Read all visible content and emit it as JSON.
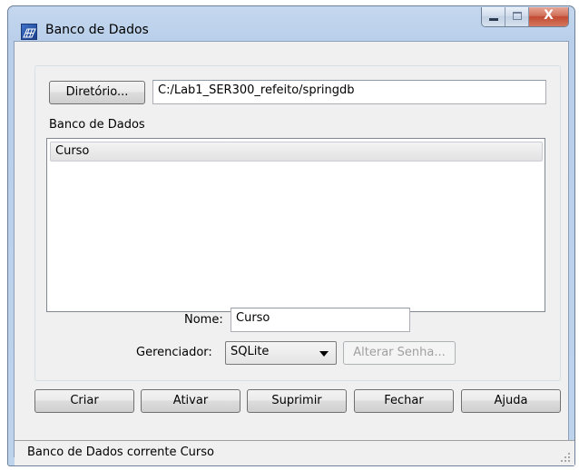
{
  "window": {
    "title": "Banco de Dados",
    "close_glyph": "X",
    "icon": "database-grid-icon"
  },
  "directory": {
    "button_label": "Diretório...",
    "path": "C:/Lab1_SER300_refeito/springdb"
  },
  "database_list": {
    "label": "Banco de Dados",
    "items": [
      "Curso"
    ]
  },
  "name_field": {
    "label": "Nome:",
    "value": "Curso"
  },
  "manager": {
    "label": "Gerenciador:",
    "selected": "SQLite",
    "change_password_label": "Alterar Senha..."
  },
  "actions": {
    "create": "Criar",
    "activate": "Ativar",
    "delete": "Suprimir",
    "close": "Fechar",
    "help": "Ajuda"
  },
  "status": {
    "text": "Banco de Dados corrente Curso"
  }
}
